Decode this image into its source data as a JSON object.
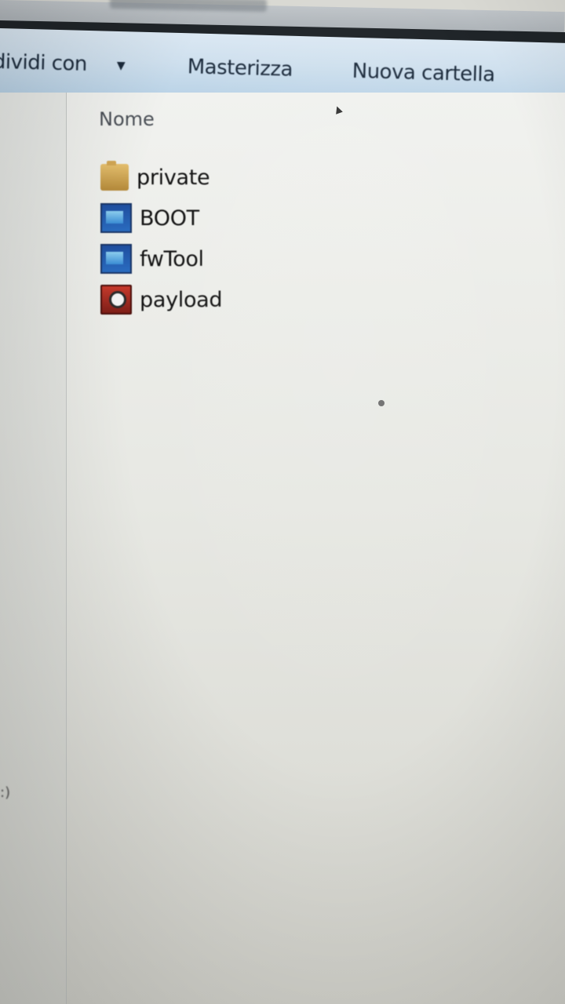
{
  "toolbar": {
    "share_with": "dividi con",
    "burn": "Masterizza",
    "new_folder": "Nuova cartella"
  },
  "nav_pane": {
    "fragment": ":)"
  },
  "file_list": {
    "column_header": "Nome",
    "items": [
      {
        "name": "private",
        "icon": "folder-icon"
      },
      {
        "name": "BOOT",
        "icon": "application-icon"
      },
      {
        "name": "fwTool",
        "icon": "application-icon"
      },
      {
        "name": "payload",
        "icon": "executable-icon"
      }
    ]
  },
  "colors": {
    "toolbar_bg": "#cfe0ee",
    "content_bg": "#e7e8e3",
    "text": "#111111"
  }
}
